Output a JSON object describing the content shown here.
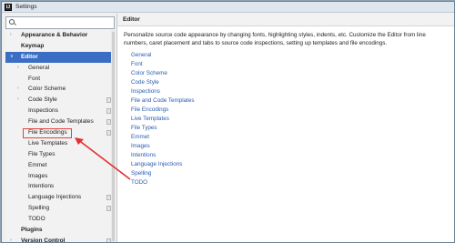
{
  "window": {
    "title": "Settings",
    "app_icon_text": "IJ"
  },
  "search": {
    "placeholder": ""
  },
  "sidebar": {
    "items": [
      {
        "label": "Appearance & Behavior",
        "bold": true,
        "indent": 0,
        "arrow": ">",
        "has_icon": false,
        "selected": false
      },
      {
        "label": "Keymap",
        "bold": true,
        "indent": 0,
        "arrow": "",
        "has_icon": false,
        "selected": false
      },
      {
        "label": "Editor",
        "bold": true,
        "indent": 0,
        "arrow": "v",
        "has_icon": false,
        "selected": true
      },
      {
        "label": "General",
        "bold": false,
        "indent": 1,
        "arrow": ">",
        "has_icon": false,
        "selected": false
      },
      {
        "label": "Font",
        "bold": false,
        "indent": 1,
        "arrow": "",
        "has_icon": false,
        "selected": false
      },
      {
        "label": "Color Scheme",
        "bold": false,
        "indent": 1,
        "arrow": ">",
        "has_icon": false,
        "selected": false
      },
      {
        "label": "Code Style",
        "bold": false,
        "indent": 1,
        "arrow": ">",
        "has_icon": true,
        "selected": false
      },
      {
        "label": "Inspections",
        "bold": false,
        "indent": 1,
        "arrow": "",
        "has_icon": true,
        "selected": false
      },
      {
        "label": "File and Code Templates",
        "bold": false,
        "indent": 1,
        "arrow": "",
        "has_icon": true,
        "selected": false
      },
      {
        "label": "File Encodings",
        "bold": false,
        "indent": 1,
        "arrow": "",
        "has_icon": true,
        "selected": false
      },
      {
        "label": "Live Templates",
        "bold": false,
        "indent": 1,
        "arrow": "",
        "has_icon": false,
        "selected": false
      },
      {
        "label": "File Types",
        "bold": false,
        "indent": 1,
        "arrow": "",
        "has_icon": false,
        "selected": false
      },
      {
        "label": "Emmet",
        "bold": false,
        "indent": 1,
        "arrow": "",
        "has_icon": false,
        "selected": false
      },
      {
        "label": "Images",
        "bold": false,
        "indent": 1,
        "arrow": "",
        "has_icon": false,
        "selected": false
      },
      {
        "label": "Intentions",
        "bold": false,
        "indent": 1,
        "arrow": "",
        "has_icon": false,
        "selected": false
      },
      {
        "label": "Language Injections",
        "bold": false,
        "indent": 1,
        "arrow": "",
        "has_icon": true,
        "selected": false
      },
      {
        "label": "Spelling",
        "bold": false,
        "indent": 1,
        "arrow": "",
        "has_icon": true,
        "selected": false
      },
      {
        "label": "TODO",
        "bold": false,
        "indent": 1,
        "arrow": "",
        "has_icon": false,
        "selected": false
      },
      {
        "label": "Plugins",
        "bold": true,
        "indent": 0,
        "arrow": "",
        "has_icon": false,
        "selected": false
      },
      {
        "label": "Version Control",
        "bold": true,
        "indent": 0,
        "arrow": ">",
        "has_icon": true,
        "selected": false
      }
    ]
  },
  "main": {
    "header": "Editor",
    "description": "Personalize source code appearance by changing fonts, highlighting styles, indents, etc. Customize the Editor from line numbers, caret placement and tabs to source code inspections, setting up templates and file encodings.",
    "links": [
      "General",
      "Font",
      "Color Scheme",
      "Code Style",
      "Inspections",
      "File and Code Templates",
      "File Encodings",
      "Live Templates",
      "File Types",
      "Emmet",
      "Images",
      "Intentions",
      "Language Injections",
      "Spelling",
      "TODO"
    ]
  },
  "annotation": {
    "box_color": "#e04040",
    "arrow_color": "#e03030",
    "highlighted_item": "File Encodings"
  },
  "colors": {
    "selection": "#3a6ec4",
    "link": "#2a5db0"
  }
}
